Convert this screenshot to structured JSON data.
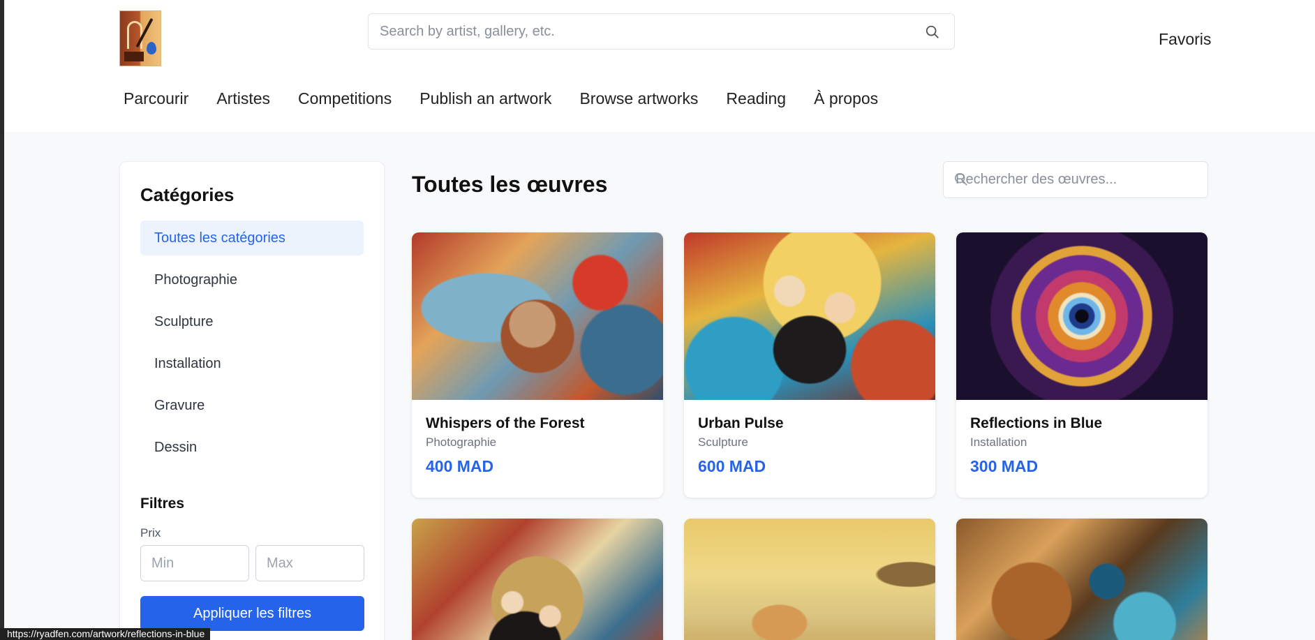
{
  "header": {
    "search_placeholder": "Search by artist, gallery, etc.",
    "favorites_label": "Favoris",
    "nav": [
      "Parcourir",
      "Artistes",
      "Competitions",
      "Publish an artwork",
      "Browse artworks",
      "Reading",
      "À propos"
    ]
  },
  "sidebar": {
    "title": "Catégories",
    "categories": [
      "Toutes les catégories",
      "Photographie",
      "Sculpture",
      "Installation",
      "Gravure",
      "Dessin"
    ],
    "active_category": "Toutes les catégories",
    "filters_title": "Filtres",
    "price_label": "Prix",
    "min_placeholder": "Min",
    "max_placeholder": "Max",
    "apply_label": "Appliquer les filtres"
  },
  "main": {
    "title": "Toutes les œuvres",
    "search_placeholder": "Rechercher des œuvres...",
    "artworks": [
      {
        "title": "Whispers of the Forest",
        "category": "Photographie",
        "price": "400 MAD"
      },
      {
        "title": "Urban Pulse",
        "category": "Sculpture",
        "price": "600 MAD"
      },
      {
        "title": "Reflections in Blue",
        "category": "Installation",
        "price": "300 MAD"
      },
      {
        "title": "",
        "category": "",
        "price": ""
      },
      {
        "title": "",
        "category": "",
        "price": ""
      },
      {
        "title": "",
        "category": "",
        "price": ""
      }
    ]
  },
  "status_bar": {
    "url": "https://ryadfen.com/artwork/reflections-in-blue"
  },
  "colors": {
    "accent": "#2563eb",
    "active_bg": "#edf3fd",
    "page_bg": "#f8f9fb"
  }
}
